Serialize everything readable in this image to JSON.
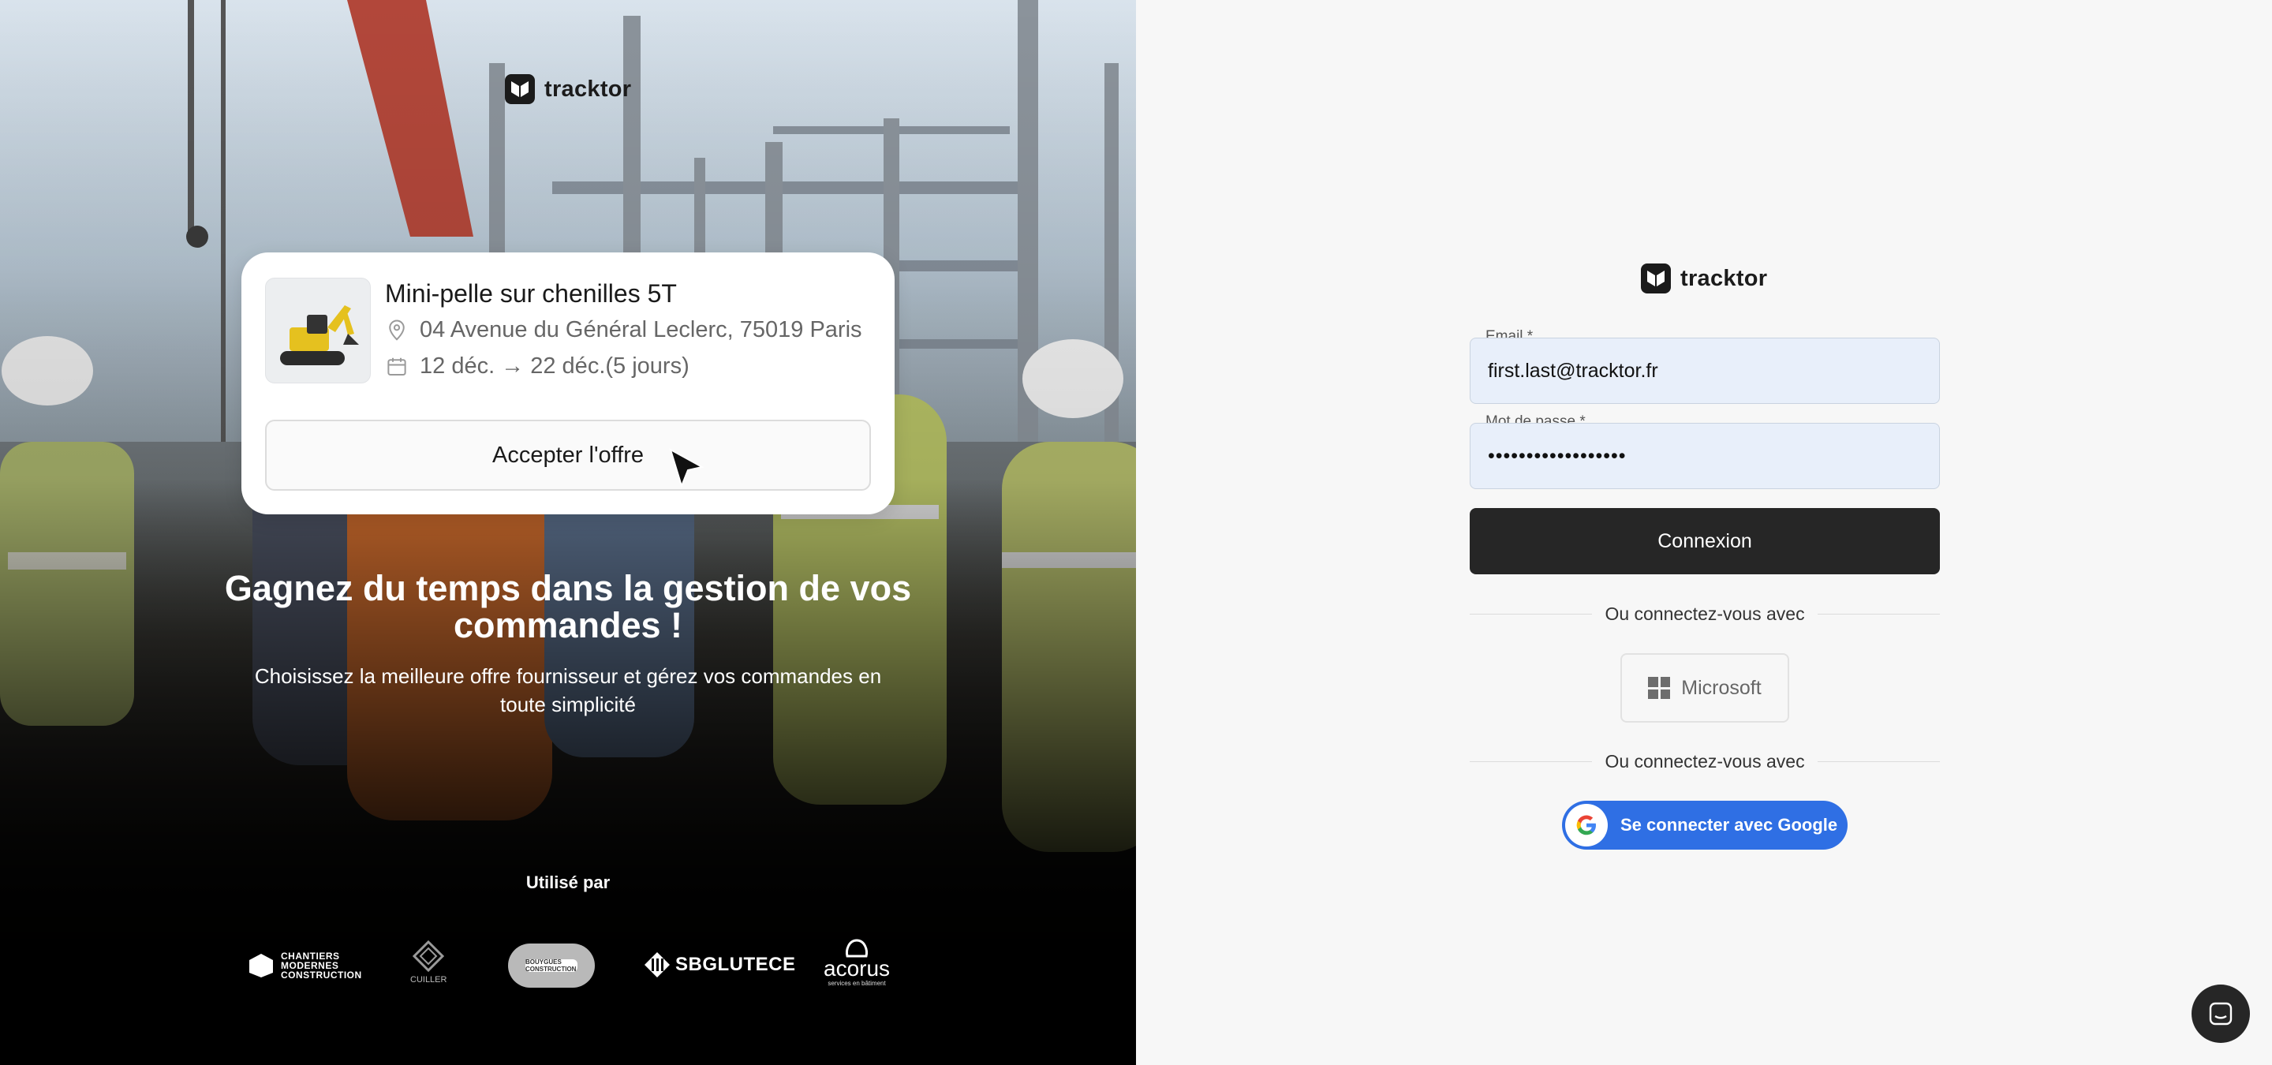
{
  "brand": {
    "name": "tracktor"
  },
  "hero": {
    "offer": {
      "title": "Mini-pelle sur chenilles 5T",
      "address": "04 Avenue du Général Leclerc, 75019 Paris",
      "dates": "12 déc. → 22  déc.(5 jours)",
      "accept_label": "Accepter l'offre"
    },
    "headline": "Gagnez du temps dans la gestion de vos commandes !",
    "subtitle": "Choisissez la meilleure offre fournisseur et gérez vos commandes en toute simplicité",
    "used_by_label": "Utilisé par",
    "partners": {
      "chantiers": "CHANTIERS MODERNES CONSTRUCTION",
      "cuiller": "CUILLER",
      "bouygues": "BOUYGUES CONSTRUCTION",
      "sbg": "SBGLUTECE",
      "acorus": "acorus",
      "acorus_tag": "services en bâtiment"
    }
  },
  "login": {
    "email_label": "Email",
    "email_value": "first.last@tracktor.fr",
    "password_label": "Mot de passe",
    "password_value": "••••••••••••••••••",
    "required_mark": "*",
    "submit_label": "Connexion",
    "divider_text": "Ou connectez-vous avec",
    "microsoft_label": "Microsoft",
    "google_label": "Se connecter avec Google"
  },
  "colors": {
    "primary_dark": "#262626",
    "input_bg": "#e8effa",
    "google_blue": "#2f6fe4",
    "panel_bg": "#f7f7f7"
  },
  "icons": [
    "location-pin-icon",
    "calendar-icon",
    "cursor-icon",
    "microsoft-icon",
    "google-icon",
    "chat-icon"
  ]
}
